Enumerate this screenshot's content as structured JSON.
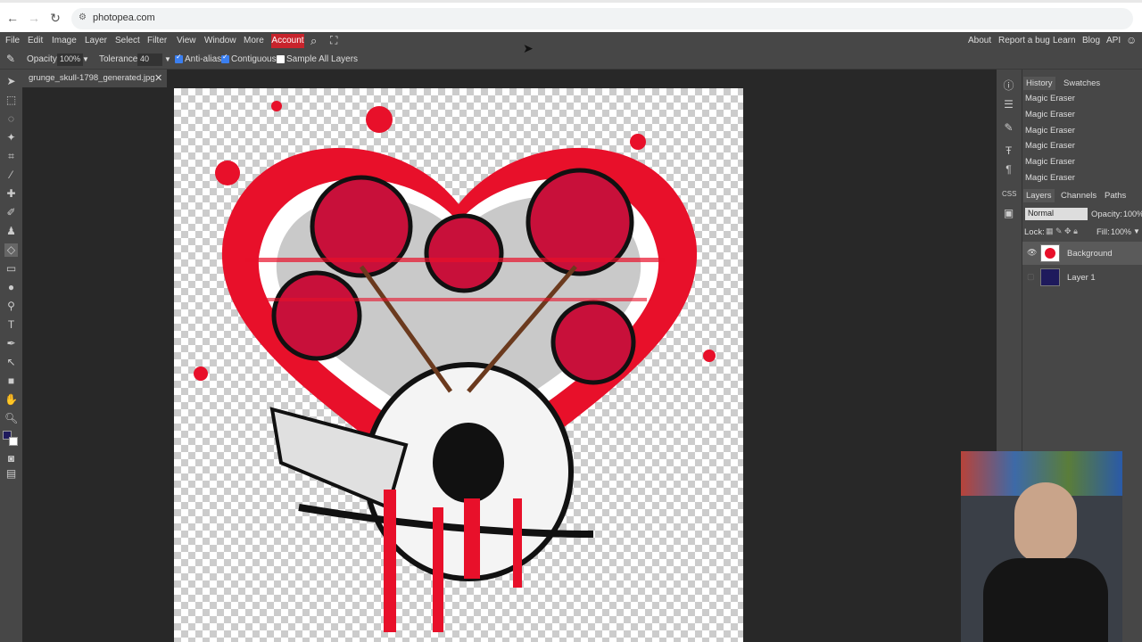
{
  "browser": {
    "url": "photopea.com"
  },
  "menu": {
    "items": [
      "File",
      "Edit",
      "Image",
      "Layer",
      "Select",
      "Filter",
      "View",
      "Window",
      "More"
    ],
    "account": "Account",
    "right_items": [
      "About",
      "Report a bug",
      "Learn",
      "Blog",
      "API"
    ]
  },
  "options": {
    "opacity_label": "Opacity:",
    "opacity_value": "100%",
    "tolerance_label": "Tolerance:",
    "tolerance_value": "40",
    "anti_alias": "Anti-alias",
    "contiguous": "Contiguous",
    "sample_all": "Sample All Layers"
  },
  "document": {
    "tab_name": "grunge_skull-1798_generated.jpg"
  },
  "panels": {
    "history_tab": "History",
    "swatches_tab": "Swatches",
    "history_items": [
      "Magic Eraser",
      "Magic Eraser",
      "Magic Eraser",
      "Magic Eraser",
      "Magic Eraser",
      "Magic Eraser"
    ],
    "layers_tab": "Layers",
    "channels_tab": "Channels",
    "paths_tab": "Paths",
    "blend_mode": "Normal",
    "opacity_label": "Opacity:",
    "opacity_value": "100%",
    "lock_label": "Lock:",
    "fill_label": "Fill:",
    "fill_value": "100%",
    "layers": [
      {
        "name": "Background"
      },
      {
        "name": "Layer 1"
      }
    ]
  },
  "colors": {
    "accent": "#c8242c",
    "foreground": "#1e1a5c",
    "background": "#ffffff"
  }
}
